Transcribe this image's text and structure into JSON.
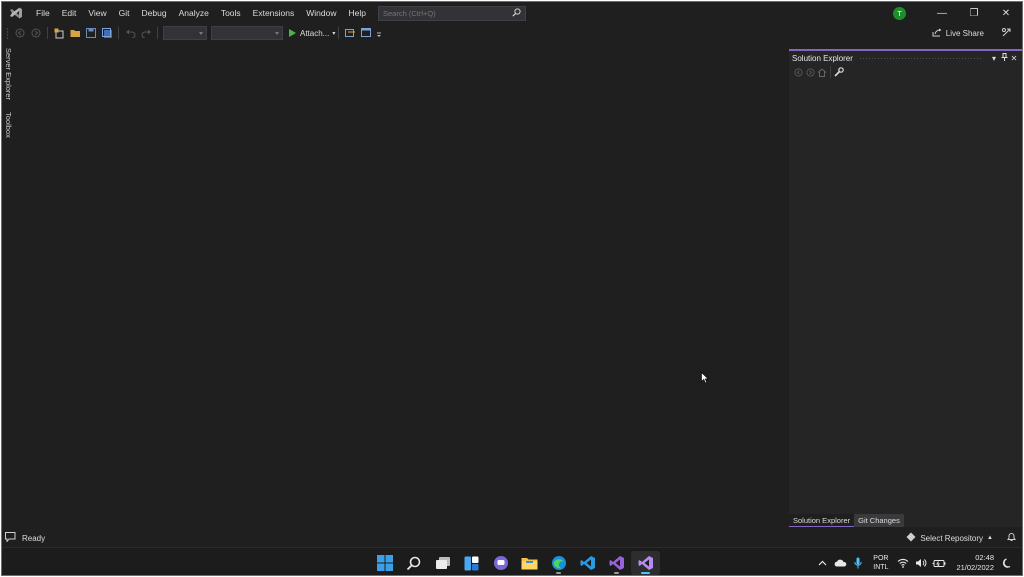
{
  "window": {
    "menu": [
      "File",
      "Edit",
      "View",
      "Git",
      "Debug",
      "Analyze",
      "Tools",
      "Extensions",
      "Window",
      "Help"
    ],
    "search_placeholder": "Search (Ctrl+Q)",
    "user_initial": "T",
    "controls": {
      "minimize": "—",
      "restore": "❐",
      "close": "✕"
    }
  },
  "toolbar": {
    "attach_label": "Attach...",
    "live_share_label": "Live Share"
  },
  "left_tabs": [
    "Server Explorer",
    "Toolbox"
  ],
  "solution_explorer": {
    "title": "Solution Explorer",
    "tabs": [
      {
        "label": "Solution Explorer",
        "active": true
      },
      {
        "label": "Git Changes",
        "active": false
      }
    ]
  },
  "statusbar": {
    "status": "Ready",
    "select_repository": "Select Repository"
  },
  "taskbar": {
    "apps": [
      "start",
      "search",
      "task-view",
      "widgets",
      "teams-chat",
      "file-explorer",
      "edge",
      "vscode",
      "visual-studio",
      "visual-studio-preview"
    ],
    "language_line1": "POR",
    "language_line2": "INTL",
    "time": "02:48",
    "date": "21/02/2022"
  },
  "colors": {
    "background": "#1f1f1f",
    "accent": "#8565c4",
    "run_green": "#4bb34b",
    "avatar_green": "#1d8f2a"
  }
}
